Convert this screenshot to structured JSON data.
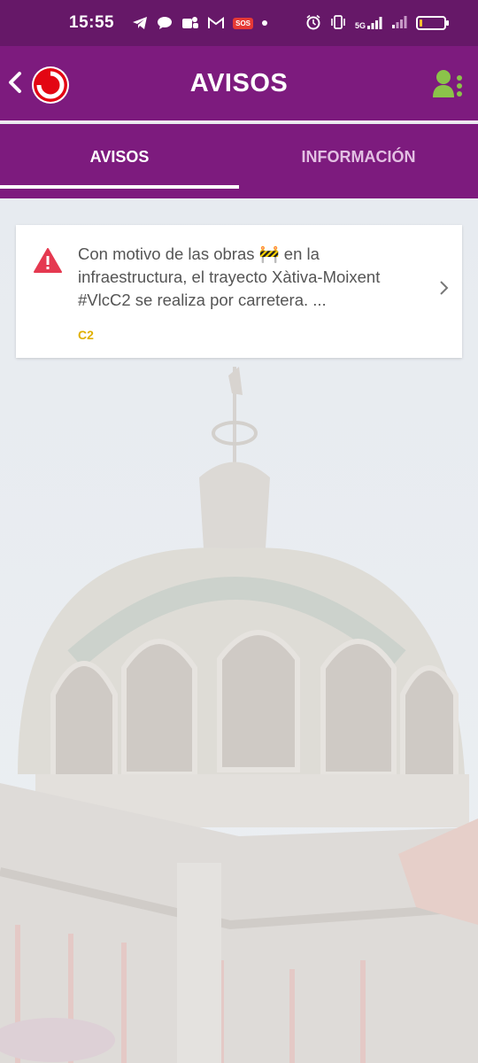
{
  "status_bar": {
    "time": "15:55",
    "sos": "SOS",
    "network": "5G",
    "battery_level": 0.12
  },
  "app_bar": {
    "title": "AVISOS"
  },
  "tabs": [
    {
      "label": "AVISOS",
      "active": true
    },
    {
      "label": "INFORMACIÓN",
      "active": false
    }
  ],
  "alert": {
    "line1": "Con motivo de las obras 🚧 en la",
    "line2": "infraestructura, el trayecto Xàtiva-Moixent",
    "line3": "#VlcC2 se realiza por carretera. ...",
    "line": "C2"
  },
  "colors": {
    "status_bar": "#661868",
    "app_bar": "#7d1b7e",
    "warning": "#e53950",
    "line_tag": "#e0b000",
    "user_icon": "#8bc34a"
  }
}
